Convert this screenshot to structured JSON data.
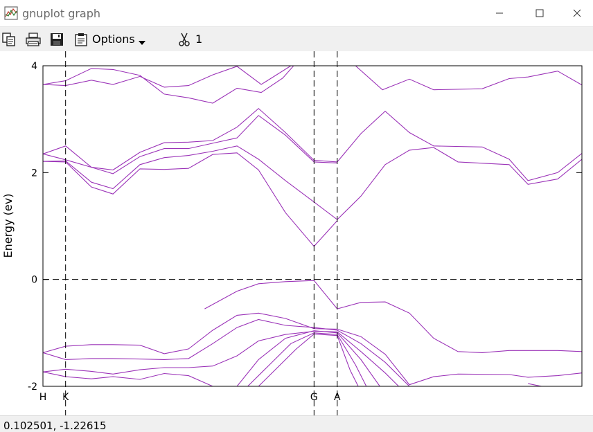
{
  "window": {
    "title": "gnuplot graph",
    "app_icon": "gnuplot-graph-icon",
    "controls": [
      "minimize-icon",
      "maximize-icon",
      "close-icon"
    ]
  },
  "toolbar": {
    "icons": [
      "copy-icon",
      "print-icon",
      "save-icon",
      "options-clipboard-icon"
    ],
    "options_label": "Options",
    "scissors_icon": "scissors-icon",
    "scissors_count": "1"
  },
  "status": {
    "coordinates": "0.102501, -1.22615"
  },
  "colors": {
    "band_line": "#9b33b8",
    "axis": "#000000",
    "window_chrome": "#f0f0f0"
  },
  "chart_data": {
    "type": "line",
    "ylabel": "Energy (ev)",
    "xlabel": "",
    "ylim": [
      -2,
      4
    ],
    "xlim": [
      0,
      1
    ],
    "yticks": [
      -2,
      0,
      2,
      4
    ],
    "xticks": [
      {
        "label": "H",
        "x": 0.0
      },
      {
        "label": "K",
        "x": 0.042
      },
      {
        "label": "G",
        "x": 0.503
      },
      {
        "label": "A",
        "x": 0.546
      }
    ],
    "vertical_dashed_x": [
      0.042,
      0.503,
      0.546
    ],
    "horizontal_dashed_y": [
      0
    ],
    "grid": false,
    "legend": "none",
    "series": [
      {
        "points": [
          [
            0,
            3.65
          ],
          [
            0.042,
            3.63
          ],
          [
            0.09,
            3.73
          ],
          [
            0.13,
            3.65
          ],
          [
            0.18,
            3.8
          ],
          [
            0.225,
            3.6
          ],
          [
            0.27,
            3.63
          ],
          [
            0.315,
            3.83
          ],
          [
            0.36,
            3.99
          ],
          [
            0.405,
            3.65
          ],
          [
            0.46,
            4.0
          ]
        ]
      },
      {
        "points": [
          [
            0,
            3.65
          ],
          [
            0.042,
            3.72
          ],
          [
            0.09,
            3.95
          ],
          [
            0.13,
            3.93
          ],
          [
            0.18,
            3.82
          ],
          [
            0.225,
            3.47
          ],
          [
            0.27,
            3.4
          ],
          [
            0.315,
            3.3
          ],
          [
            0.36,
            3.58
          ],
          [
            0.405,
            3.5
          ],
          [
            0.445,
            3.77
          ],
          [
            0.465,
            4.0
          ]
        ]
      },
      {
        "points": [
          [
            0.58,
            4.0
          ],
          [
            0.63,
            3.55
          ],
          [
            0.68,
            3.75
          ],
          [
            0.725,
            3.55
          ],
          [
            0.815,
            3.57
          ],
          [
            0.865,
            3.76
          ],
          [
            0.9,
            3.79
          ],
          [
            0.955,
            3.9
          ],
          [
            1.0,
            3.64
          ]
        ]
      },
      {
        "points": [
          [
            0,
            2.35
          ],
          [
            0.042,
            2.5
          ],
          [
            0.09,
            2.1
          ],
          [
            0.13,
            2.05
          ],
          [
            0.18,
            2.38
          ],
          [
            0.225,
            2.56
          ],
          [
            0.27,
            2.57
          ],
          [
            0.315,
            2.6
          ],
          [
            0.36,
            2.85
          ],
          [
            0.4,
            3.2
          ],
          [
            0.45,
            2.75
          ],
          [
            0.503,
            2.23
          ],
          [
            0.546,
            2.2
          ],
          [
            0.59,
            2.73
          ],
          [
            0.635,
            3.15
          ],
          [
            0.68,
            2.75
          ],
          [
            0.725,
            2.5
          ],
          [
            0.815,
            2.48
          ],
          [
            0.865,
            2.25
          ],
          [
            0.9,
            1.85
          ],
          [
            0.955,
            2.0
          ],
          [
            1.0,
            2.36
          ]
        ]
      },
      {
        "points": [
          [
            0,
            2.35
          ],
          [
            0.042,
            2.24
          ],
          [
            0.09,
            2.1
          ],
          [
            0.13,
            1.98
          ],
          [
            0.18,
            2.3
          ],
          [
            0.225,
            2.45
          ],
          [
            0.27,
            2.45
          ],
          [
            0.315,
            2.55
          ],
          [
            0.36,
            2.65
          ],
          [
            0.4,
            3.07
          ],
          [
            0.45,
            2.7
          ],
          [
            0.503,
            2.2
          ],
          [
            0.546,
            2.18
          ]
        ]
      },
      {
        "points": [
          [
            0,
            2.21
          ],
          [
            0.042,
            2.22
          ],
          [
            0.09,
            1.82
          ],
          [
            0.13,
            1.7
          ],
          [
            0.18,
            2.15
          ],
          [
            0.225,
            2.28
          ],
          [
            0.27,
            2.32
          ],
          [
            0.315,
            2.4
          ],
          [
            0.36,
            2.5
          ],
          [
            0.4,
            2.25
          ],
          [
            0.45,
            1.85
          ],
          [
            0.503,
            1.45
          ],
          [
            0.546,
            1.12
          ],
          [
            0.59,
            1.56
          ],
          [
            0.635,
            2.15
          ],
          [
            0.68,
            2.42
          ],
          [
            0.725,
            2.47
          ],
          [
            0.77,
            2.2
          ],
          [
            0.865,
            2.15
          ],
          [
            0.9,
            1.78
          ],
          [
            0.955,
            1.88
          ],
          [
            1.0,
            2.25
          ]
        ]
      },
      {
        "points": [
          [
            0,
            2.21
          ],
          [
            0.042,
            2.2
          ],
          [
            0.09,
            1.73
          ],
          [
            0.13,
            1.6
          ],
          [
            0.18,
            2.07
          ],
          [
            0.225,
            2.06
          ],
          [
            0.27,
            2.08
          ],
          [
            0.315,
            2.34
          ],
          [
            0.36,
            2.37
          ],
          [
            0.4,
            2.05
          ],
          [
            0.45,
            1.25
          ],
          [
            0.503,
            0.62
          ],
          [
            0.546,
            1.1
          ]
        ]
      },
      {
        "points": [
          [
            0.3,
            -0.55
          ],
          [
            0.36,
            -0.22
          ],
          [
            0.4,
            -0.08
          ],
          [
            0.45,
            -0.04
          ],
          [
            0.503,
            -0.02
          ],
          [
            0.546,
            -0.55
          ],
          [
            0.59,
            -0.43
          ],
          [
            0.635,
            -0.42
          ],
          [
            0.68,
            -0.63
          ],
          [
            0.725,
            -1.1
          ],
          [
            0.77,
            -1.35
          ],
          [
            0.815,
            -1.37
          ],
          [
            0.865,
            -1.33
          ],
          [
            0.955,
            -1.33
          ],
          [
            1.0,
            -1.35
          ]
        ]
      },
      {
        "points": [
          [
            0,
            -1.37
          ],
          [
            0.042,
            -1.25
          ],
          [
            0.09,
            -1.22
          ],
          [
            0.13,
            -1.22
          ],
          [
            0.18,
            -1.23
          ],
          [
            0.225,
            -1.39
          ],
          [
            0.27,
            -1.3
          ],
          [
            0.315,
            -0.95
          ],
          [
            0.36,
            -0.67
          ],
          [
            0.4,
            -0.63
          ],
          [
            0.45,
            -0.73
          ],
          [
            0.503,
            -0.92
          ],
          [
            0.546,
            -0.93
          ],
          [
            0.59,
            -1.07
          ],
          [
            0.635,
            -1.4
          ],
          [
            0.68,
            -1.97
          ],
          [
            0.725,
            -1.82
          ],
          [
            0.77,
            -1.77
          ],
          [
            0.865,
            -1.78
          ],
          [
            0.9,
            -1.83
          ],
          [
            0.955,
            -1.8
          ],
          [
            1.0,
            -1.75
          ]
        ]
      },
      {
        "points": [
          [
            0,
            -1.37
          ],
          [
            0.042,
            -1.5
          ],
          [
            0.09,
            -1.48
          ],
          [
            0.13,
            -1.48
          ],
          [
            0.18,
            -1.49
          ],
          [
            0.225,
            -1.5
          ],
          [
            0.27,
            -1.48
          ],
          [
            0.315,
            -1.2
          ],
          [
            0.36,
            -0.9
          ],
          [
            0.4,
            -0.75
          ],
          [
            0.45,
            -0.86
          ],
          [
            0.503,
            -0.9
          ],
          [
            0.546,
            -0.95
          ],
          [
            0.59,
            -1.2
          ],
          [
            0.635,
            -1.55
          ],
          [
            0.68,
            -2.0
          ]
        ]
      },
      {
        "points": [
          [
            0,
            -1.73
          ],
          [
            0.042,
            -1.68
          ],
          [
            0.09,
            -1.72
          ],
          [
            0.13,
            -1.77
          ],
          [
            0.18,
            -1.69
          ],
          [
            0.225,
            -1.65
          ],
          [
            0.27,
            -1.65
          ],
          [
            0.315,
            -1.62
          ],
          [
            0.36,
            -1.43
          ],
          [
            0.4,
            -1.15
          ],
          [
            0.45,
            -1.03
          ],
          [
            0.503,
            -0.97
          ],
          [
            0.546,
            -0.98
          ],
          [
            0.59,
            -1.35
          ],
          [
            0.635,
            -1.75
          ],
          [
            0.66,
            -2.0
          ]
        ]
      },
      {
        "points": [
          [
            0,
            -1.73
          ],
          [
            0.042,
            -1.82
          ],
          [
            0.09,
            -1.86
          ],
          [
            0.13,
            -1.82
          ],
          [
            0.18,
            -1.87
          ],
          [
            0.225,
            -1.76
          ],
          [
            0.27,
            -1.8
          ],
          [
            0.315,
            -2.0
          ]
        ]
      },
      {
        "points": [
          [
            0.36,
            -2.0
          ],
          [
            0.4,
            -1.5
          ],
          [
            0.45,
            -1.1
          ],
          [
            0.503,
            -0.96
          ],
          [
            0.546,
            -1.0
          ],
          [
            0.59,
            -1.5
          ],
          [
            0.625,
            -2.0
          ]
        ]
      },
      {
        "points": [
          [
            0.38,
            -2.0
          ],
          [
            0.42,
            -1.6
          ],
          [
            0.46,
            -1.2
          ],
          [
            0.503,
            -1.0
          ],
          [
            0.546,
            -1.03
          ],
          [
            0.58,
            -1.6
          ],
          [
            0.6,
            -2.0
          ]
        ]
      },
      {
        "points": [
          [
            0.4,
            -2.0
          ],
          [
            0.43,
            -1.7
          ],
          [
            0.47,
            -1.3
          ],
          [
            0.503,
            -1.02
          ],
          [
            0.546,
            -1.05
          ],
          [
            0.57,
            -1.7
          ],
          [
            0.585,
            -2.0
          ]
        ]
      },
      {
        "points": [
          [
            0.9,
            -1.95
          ],
          [
            0.925,
            -2.0
          ]
        ]
      }
    ]
  }
}
